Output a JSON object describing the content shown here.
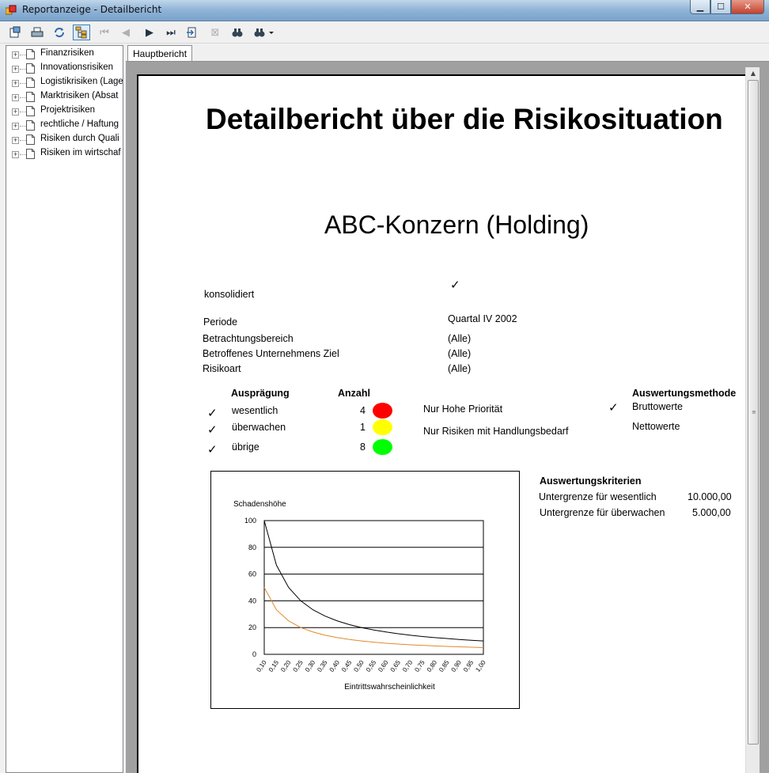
{
  "window": {
    "title": "Reportanzeige - Detailbericht",
    "minimize": "▁",
    "maximize": "☐",
    "close": "✕"
  },
  "tree": {
    "items": [
      {
        "label": "Finanzrisiken"
      },
      {
        "label": "Innovationsrisiken"
      },
      {
        "label": "Logistikrisiken (Lage"
      },
      {
        "label": "Marktrisiken (Absat"
      },
      {
        "label": "Projektrisiken"
      },
      {
        "label": "rechtliche / Haftung"
      },
      {
        "label": "Risiken durch Quali"
      },
      {
        "label": "Risiken im wirtschaf"
      }
    ]
  },
  "tabs": [
    {
      "label": "Hauptbericht"
    }
  ],
  "report": {
    "title": "Detailbericht über die Risikosituation",
    "company": "ABC-Konzern (Holding)",
    "consolidated_label": "konsolidiert",
    "check_mark": "✓",
    "params": [
      {
        "label": "Periode",
        "value": "Quartal IV 2002"
      },
      {
        "label": "Betrachtungsbereich",
        "value": "(Alle)"
      },
      {
        "label": "Betroffenes Unternehmens Ziel",
        "value": "(Alle)"
      },
      {
        "label": "Risikoart",
        "value": "(Alle)"
      }
    ],
    "auspraegung_header": "Ausprägung",
    "anzahl_header": "Anzahl",
    "levels": [
      {
        "label": "wesentlich",
        "count": "4",
        "color": "#ff0000"
      },
      {
        "label": "überwachen",
        "count": "1",
        "color": "#ffff00"
      },
      {
        "label": "übrige",
        "count": "8",
        "color": "#00ff00"
      }
    ],
    "filters": [
      "Nur Hohe Priorität",
      "Nur Risiken mit Handlungsbedarf"
    ],
    "method_header": "Auswertungsmethode",
    "methods": [
      "Bruttowerte",
      "Nettowerte"
    ],
    "criteria_header": "Auswertungskriterien",
    "criteria": [
      {
        "label": "Untergrenze für wesentlich",
        "value": "10.000,00"
      },
      {
        "label": "Untergrenze für überwachen",
        "value": "5.000,00"
      }
    ]
  },
  "chart_data": {
    "type": "line",
    "ylabel": "Schadenshöhe",
    "xlabel": "Eintrittswahrscheinlichkeit",
    "ylim": [
      0,
      100
    ],
    "yticks": [
      "0",
      "20",
      "40",
      "60",
      "80",
      "100"
    ],
    "x": [
      0.1,
      0.15,
      0.2,
      0.25,
      0.3,
      0.35,
      0.4,
      0.45,
      0.5,
      0.55,
      0.6,
      0.65,
      0.7,
      0.75,
      0.8,
      0.85,
      0.9,
      0.95,
      1.0
    ],
    "xticks": [
      "0,10",
      "0,15",
      "0,20",
      "0,25",
      "0,30",
      "0,35",
      "0,40",
      "0,45",
      "0,50",
      "0,55",
      "0,60",
      "0,65",
      "0,70",
      "0,75",
      "0,80",
      "0,85",
      "0,90",
      "0,95",
      "1,00"
    ],
    "grid": true,
    "series": [
      {
        "color": "#000000",
        "values": [
          100,
          66.7,
          50,
          40,
          33.3,
          28.6,
          25,
          22.2,
          20,
          18.2,
          16.7,
          15.4,
          14.3,
          13.3,
          12.5,
          11.8,
          11.1,
          10.5,
          10
        ]
      },
      {
        "color": "#e08a2c",
        "values": [
          50,
          33.3,
          25,
          20,
          16.7,
          14.3,
          12.5,
          11.1,
          10,
          9.1,
          8.3,
          7.7,
          7.1,
          6.7,
          6.3,
          5.9,
          5.6,
          5.3,
          5
        ]
      }
    ]
  }
}
